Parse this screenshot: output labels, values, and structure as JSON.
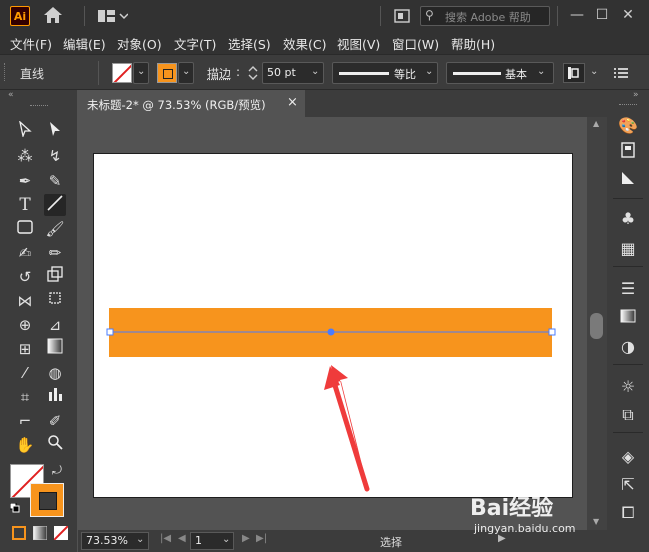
{
  "app": {
    "logo_text": "Ai",
    "search_placeholder": "搜索 Adobe 帮助"
  },
  "menu": [
    "文件(F)",
    "编辑(E)",
    "对象(O)",
    "文字(T)",
    "选择(S)",
    "效果(C)",
    "视图(V)",
    "窗口(W)",
    "帮助(H)"
  ],
  "control": {
    "tool_label": "直线",
    "stroke_label": "描边",
    "stroke_weight": "50 pt",
    "stroke_profile": "等比",
    "brush": "基本"
  },
  "document": {
    "tab_title": "未标题-2* @ 73.53% (RGB/预览)",
    "close": "×"
  },
  "status": {
    "zoom": "73.53%",
    "page": "1",
    "tool": "选择"
  },
  "watermark": {
    "text": "Bai经验",
    "sub": "jingyan.baidu.com"
  },
  "colors": {
    "fill": "#f7941d",
    "accent": "#ff9a00",
    "selection": "#4a7cff",
    "arrow": "#ef3b3b"
  }
}
